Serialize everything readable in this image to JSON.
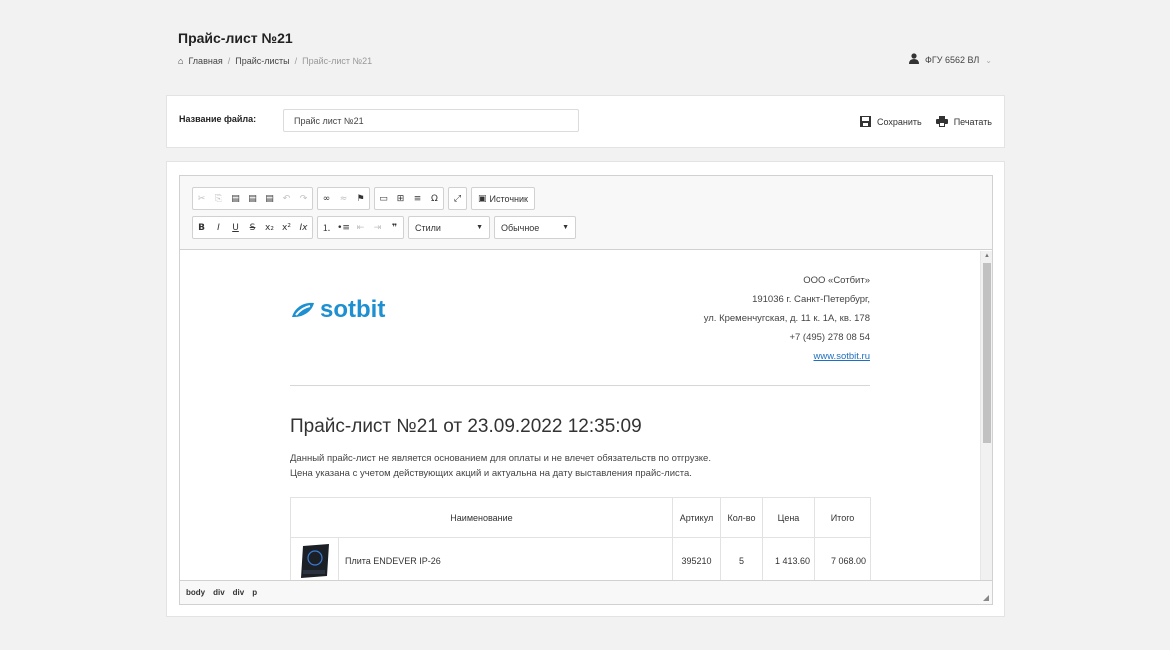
{
  "page": {
    "title": "Прайс-лист №21",
    "breadcrumb": [
      "Главная",
      "Прайс-листы",
      "Прайс-лист №21"
    ],
    "user": "ФГУ 6562 ВЛ"
  },
  "file": {
    "label": "Название файла:",
    "value": "Прайс лист №21",
    "save_label": "Сохранить",
    "print_label": "Печатать"
  },
  "toolbar": {
    "source_label": "Источник",
    "styles_label": "Стили",
    "format_label": "Обычное",
    "row1_icons": [
      "cut-icon",
      "copy-icon",
      "paste-icon",
      "paste-text-icon",
      "paste-word-icon",
      "undo-icon",
      "redo-icon",
      "link-icon",
      "unlink-icon",
      "anchor-icon",
      "image-icon",
      "table-icon",
      "horizontal-line-icon",
      "special-char-icon",
      "maximize-icon",
      "source-icon"
    ],
    "row2_icons": [
      "bold-icon",
      "italic-icon",
      "underline-icon",
      "strike-icon",
      "subscript-icon",
      "superscript-icon",
      "remove-format-icon",
      "numbered-list-icon",
      "bulleted-list-icon",
      "outdent-icon",
      "indent-icon",
      "blockquote-icon"
    ]
  },
  "document": {
    "logo_text": "sotbit",
    "company_lines": [
      "ООО «Сотбит»",
      "191036 г. Санкт-Петербург,",
      "ул. Кременчугская, д. 11 к. 1А, кв. 178",
      "+7 (495) 278 08 54"
    ],
    "website": "www.sotbit.ru",
    "heading": "Прайс-лист №21 от 23.09.2022 12:35:09",
    "note_line1": "Данный прайс-лист не является основанием для оплаты и не влечет обязательств по отгрузке.",
    "note_line2": "Цена указана с учетом действующих акций и актуальна на дату выставления прайс-листа.",
    "table": {
      "headers": [
        "Наименование",
        "Артикул",
        "Кол-во",
        "Цена",
        "Итого"
      ],
      "rows": [
        {
          "name": "Плита ENDEVER IP-26",
          "article": "395210",
          "qty": "5",
          "price": "1 413.60",
          "total": "7 068.00"
        }
      ]
    }
  },
  "statusbar": [
    "body",
    "div",
    "div",
    "p"
  ],
  "colors": {
    "brand": "#1e8fd0",
    "link": "#1e6fc0",
    "background": "#f2f2f2"
  }
}
